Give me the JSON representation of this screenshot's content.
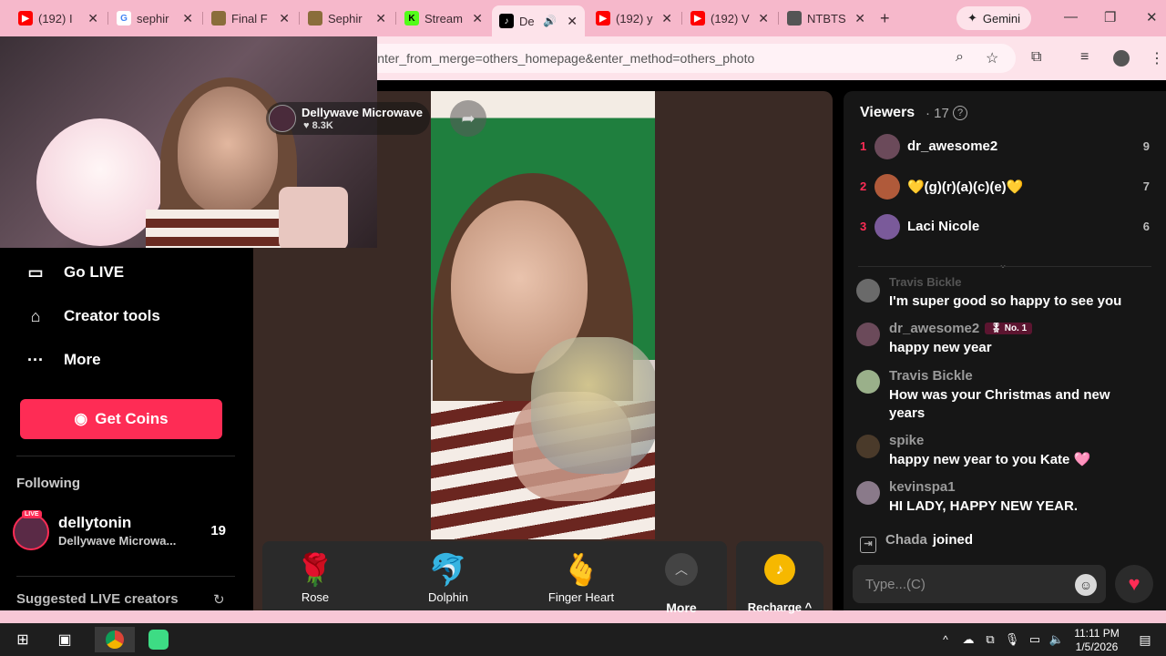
{
  "browser": {
    "tabs": [
      {
        "title": "(192) I",
        "icon": "youtube-icon",
        "color": "#ff0000"
      },
      {
        "title": "sephir",
        "icon": "google-icon",
        "color": "#4285f4"
      },
      {
        "title": "Final F",
        "icon": "web-icon",
        "color": "#8a6d3b"
      },
      {
        "title": "Sephir",
        "icon": "web-icon",
        "color": "#8a6d3b"
      },
      {
        "title": "Stream",
        "icon": "kick-icon",
        "color": "#53fc18"
      },
      {
        "title": "De",
        "icon": "tiktok-icon",
        "color": "#000000"
      },
      {
        "title": "(192) y",
        "icon": "youtube-icon",
        "color": "#ff0000"
      },
      {
        "title": "(192) V",
        "icon": "youtube-icon",
        "color": "#ff0000"
      },
      {
        "title": "NTBTS",
        "icon": "web-icon",
        "color": "#555555"
      }
    ],
    "gemini_label": "Gemini",
    "url": "https://www.tiktok.com/@dellytonin/live?enter_from_merge=others_homepage&enter_method=others_photo"
  },
  "stream": {
    "name": "Dellywave Microwave",
    "likes": "8.3K"
  },
  "sidebar": {
    "items": [
      {
        "label": "Go LIVE",
        "icon": "video-camera-icon"
      },
      {
        "label": "Creator tools",
        "icon": "creator-tools-icon"
      },
      {
        "label": "More",
        "icon": "more-dots-icon"
      }
    ],
    "get_coins": "Get Coins",
    "following_label": "Following",
    "following": {
      "name": "dellytonin",
      "subtitle": "Dellywave Microwa...",
      "count": "19",
      "badge": "LIVE"
    },
    "suggested_label": "Suggested LIVE creators"
  },
  "gifts": [
    {
      "label": "Rose",
      "glyph": "🌹"
    },
    {
      "label": "Dolphin",
      "glyph": "🐬"
    },
    {
      "label": "Finger Heart",
      "glyph": "🫰"
    }
  ],
  "gifts_more": "More",
  "recharge": "Recharge ^",
  "viewers": {
    "title": "Viewers",
    "count": "· 17",
    "ranks": [
      {
        "rank": "1",
        "name": "dr_awesome2",
        "score": "9",
        "avatar_color": "#6b4a5a"
      },
      {
        "rank": "2",
        "name": "💛(g)(r)(a)(c)(e)💛",
        "score": "7",
        "avatar_color": "#b05a3a"
      },
      {
        "rank": "3",
        "name": "Laci Nicole",
        "score": "6",
        "avatar_color": "#7a5a9a"
      }
    ]
  },
  "chat": {
    "messages": [
      {
        "user": "Travis Bickle",
        "text": "I'm super good so happy to see you",
        "badge": "",
        "avatar_color": "#6a6a6a"
      },
      {
        "user": "dr_awesome2",
        "text": "happy new year",
        "badge": "No. 1",
        "avatar_color": "#6b4a5a"
      },
      {
        "user": "Travis Bickle",
        "text": "How was your Christmas and new years",
        "badge": "",
        "avatar_color": "#9ab08a"
      },
      {
        "user": "spike",
        "text": "happy new year to you Kate 🩷",
        "badge": "",
        "avatar_color": "#4a3a2a"
      },
      {
        "user": "kevinspa1",
        "text": "HI LADY, HAPPY NEW YEAR.",
        "badge": "",
        "avatar_color": "#8a7a8a"
      }
    ],
    "joined": {
      "user": "Chada",
      "text": "joined"
    },
    "input_placeholder": "Type...(C)"
  },
  "taskbar": {
    "time": "11:11 PM",
    "date": "1/5/2026"
  }
}
